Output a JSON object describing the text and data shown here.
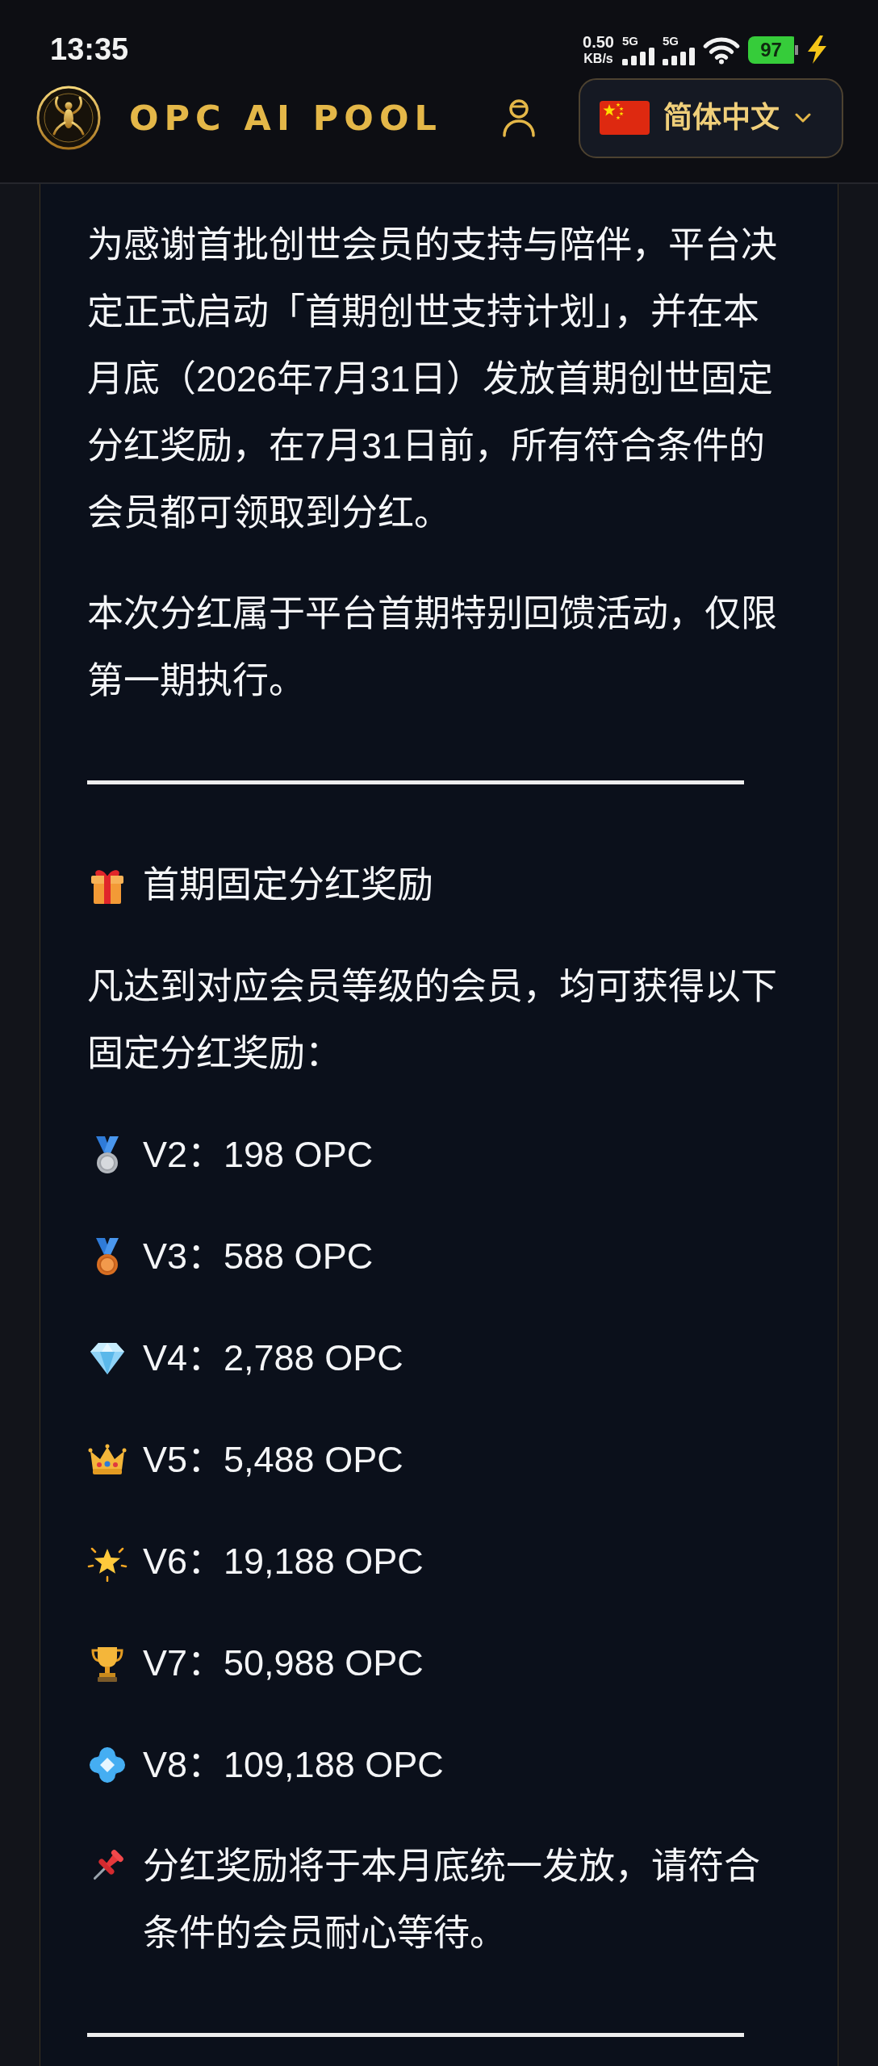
{
  "status_bar": {
    "time": "13:35",
    "network_speed": {
      "value": "0.50",
      "unit": "KB/s"
    },
    "networks": [
      {
        "label": "5G"
      },
      {
        "label": "5G"
      }
    ],
    "battery": {
      "percent": "97",
      "charging": true
    }
  },
  "header": {
    "brand": "OPC AI POOL",
    "language": {
      "label": "简体中文"
    }
  },
  "article": {
    "intro": [
      "为感谢首批创世会员的支持与陪伴，平台决定正式启动「首期创世支持计划」，并在本月底（2026年7月31日）发放首期创世固定分红奖励，在7月31日前，所有符合条件的会员都可领取到分红。",
      "本次分红属于平台首期特别回馈活动，仅限第一期执行。"
    ],
    "rewards": {
      "title": "首期固定分红奖励",
      "description": "凡达到对应会员等级的会员，均可获得以下固定分红奖励：",
      "tiers": [
        "V2：198 OPC",
        "V3：588 OPC",
        "V4：2,788 OPC",
        "V5：5,488 OPC",
        "V6：19,188 OPC",
        "V7：50,988 OPC",
        "V8：109,188 OPC"
      ],
      "note": "分红奖励将于本月底统一发放，请符合条件的会员耐心等待。"
    }
  }
}
